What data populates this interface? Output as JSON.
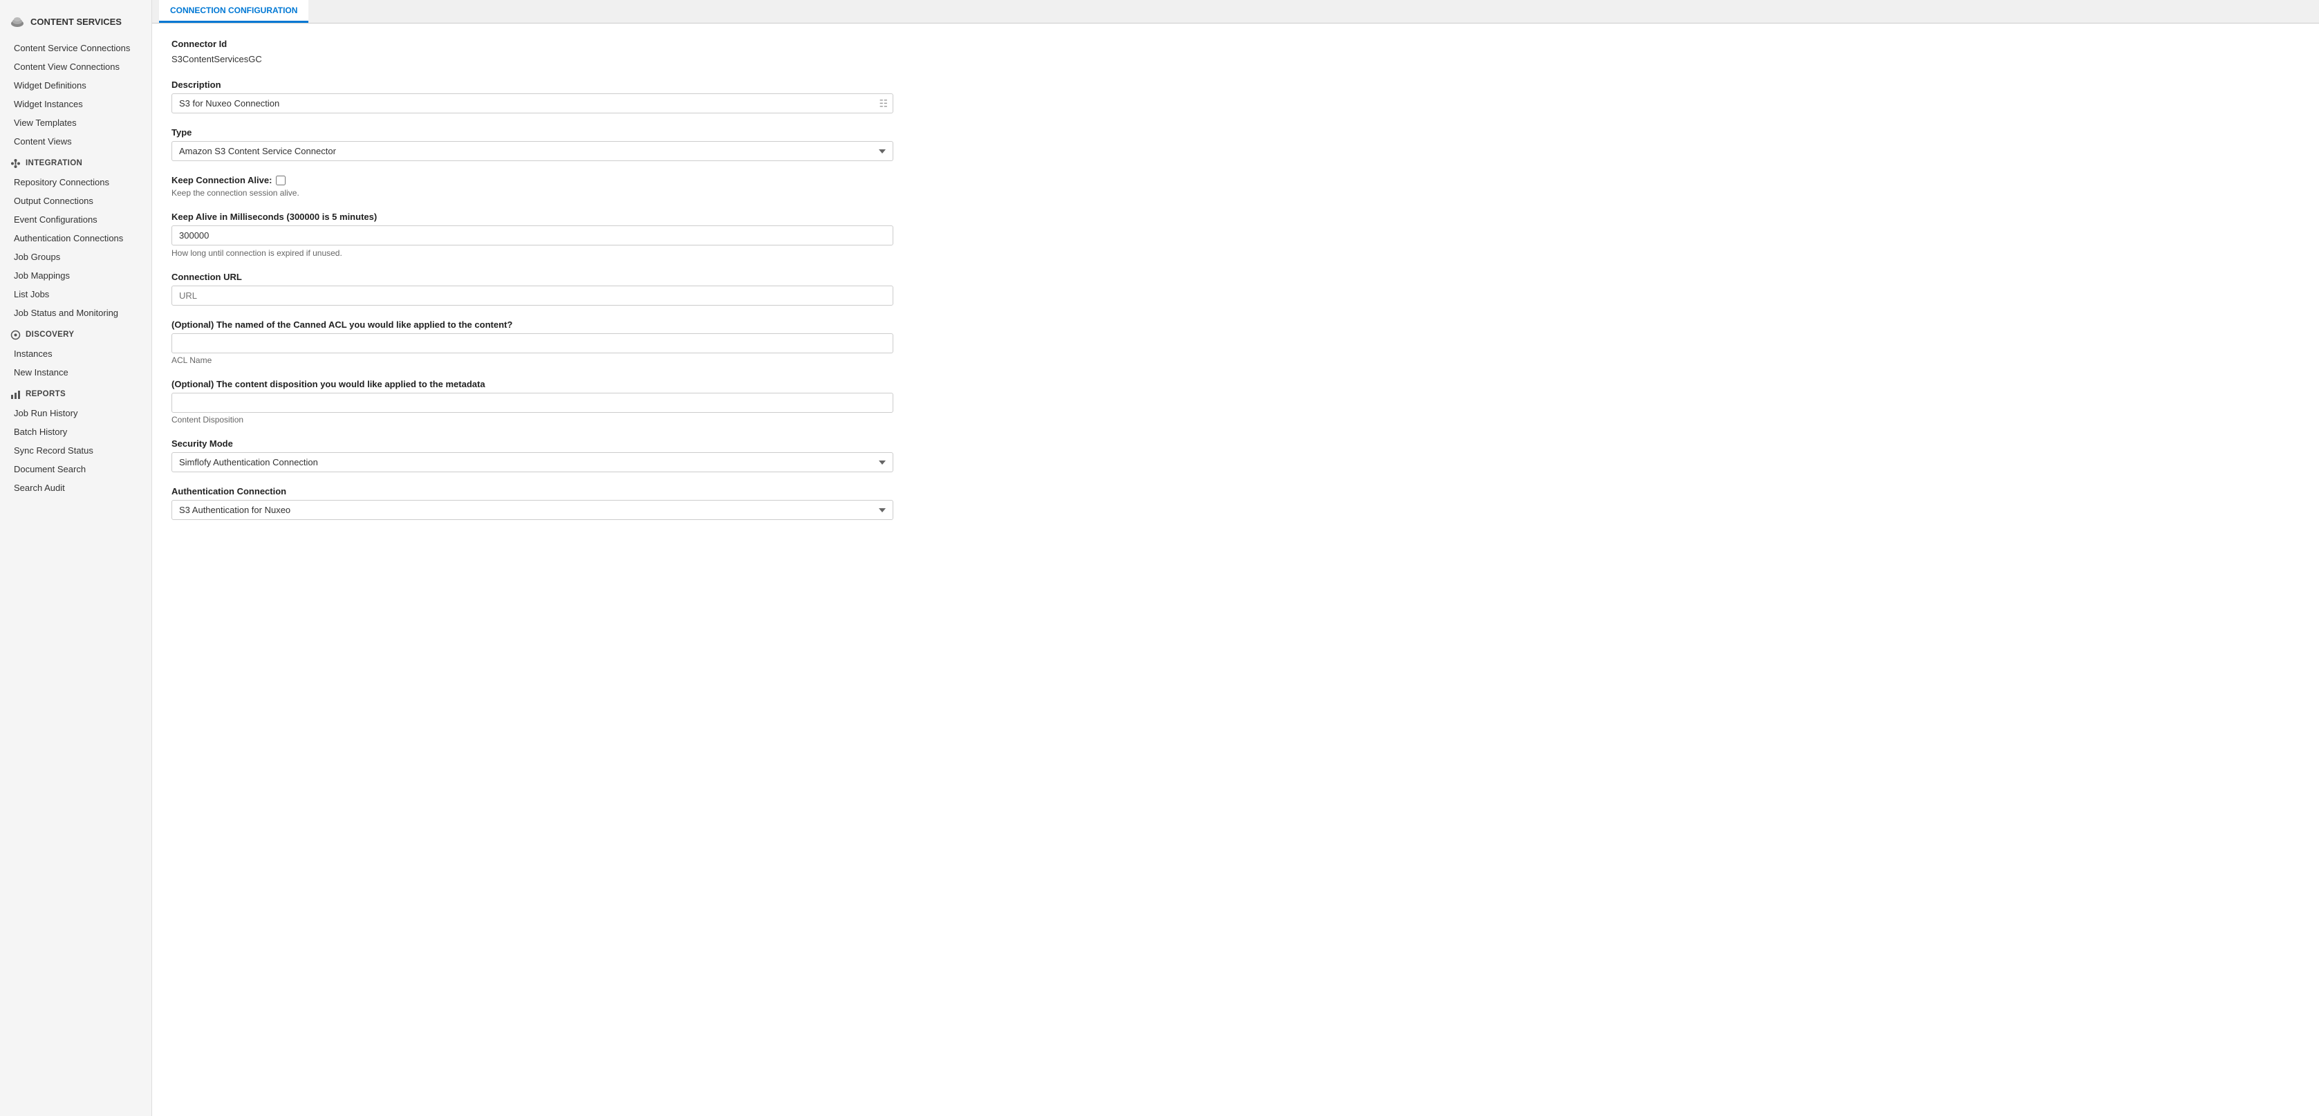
{
  "brand": {
    "icon": "☁",
    "label": "CONTENT SERVICES"
  },
  "sidebar": {
    "sections": [
      {
        "id": "content-services",
        "icon": "cloud",
        "label": "CONTENT SERVICES",
        "items": [
          {
            "id": "content-service-connections",
            "label": "Content Service Connections"
          },
          {
            "id": "content-view-connections",
            "label": "Content View Connections"
          },
          {
            "id": "widget-definitions",
            "label": "Widget Definitions"
          },
          {
            "id": "widget-instances",
            "label": "Widget Instances"
          },
          {
            "id": "view-templates",
            "label": "View Templates"
          },
          {
            "id": "content-views",
            "label": "Content Views"
          }
        ]
      },
      {
        "id": "integration",
        "icon": "stack",
        "label": "INTEGRATION",
        "items": [
          {
            "id": "repository-connections",
            "label": "Repository Connections"
          },
          {
            "id": "output-connections",
            "label": "Output Connections"
          },
          {
            "id": "event-configurations",
            "label": "Event Configurations"
          },
          {
            "id": "authentication-connections",
            "label": "Authentication Connections"
          },
          {
            "id": "job-groups",
            "label": "Job Groups"
          },
          {
            "id": "job-mappings",
            "label": "Job Mappings"
          },
          {
            "id": "list-jobs",
            "label": "List Jobs"
          },
          {
            "id": "job-status-monitoring",
            "label": "Job Status and Monitoring"
          }
        ]
      },
      {
        "id": "discovery",
        "icon": "circle",
        "label": "DISCOVERY",
        "items": [
          {
            "id": "instances",
            "label": "Instances"
          },
          {
            "id": "new-instance",
            "label": "New Instance"
          }
        ]
      },
      {
        "id": "reports",
        "icon": "bar-chart",
        "label": "REPORTS",
        "items": [
          {
            "id": "job-run-history",
            "label": "Job Run History"
          },
          {
            "id": "batch-history",
            "label": "Batch History"
          },
          {
            "id": "sync-record-status",
            "label": "Sync Record Status"
          },
          {
            "id": "document-search",
            "label": "Document Search"
          },
          {
            "id": "search-audit",
            "label": "Search Audit"
          }
        ]
      }
    ]
  },
  "tabs": [
    {
      "id": "connection-config",
      "label": "CONNECTION CONFIGURATION",
      "active": true
    }
  ],
  "form": {
    "connector_id_label": "Connector Id",
    "connector_id_value": "S3ContentServicesGC",
    "description_label": "Description",
    "description_placeholder": "",
    "description_value": "S3 for Nuxeo Connection",
    "type_label": "Type",
    "type_value": "Amazon S3 Content Service Connector",
    "type_options": [
      "Amazon S3 Content Service Connector"
    ],
    "keep_alive_label": "Keep Connection Alive:",
    "keep_alive_hint": "Keep the connection session alive.",
    "keep_alive_ms_label": "Keep Alive in Milliseconds (300000 is 5 minutes)",
    "keep_alive_ms_value": "300000",
    "keep_alive_ms_hint": "How long until connection is expired if unused.",
    "connection_url_label": "Connection URL",
    "connection_url_placeholder": "URL",
    "connection_url_value": "",
    "canned_acl_label": "(Optional) The named of the Canned ACL you would like applied to the content?",
    "canned_acl_value": "",
    "acl_name_hint": "ACL Name",
    "content_disposition_label": "(Optional) The content disposition you would like applied to the metadata",
    "content_disposition_value": "",
    "content_disposition_hint": "Content Disposition",
    "security_mode_label": "Security Mode",
    "security_mode_value": "Simflofy Authentication Connection",
    "security_mode_options": [
      "Simflofy Authentication Connection"
    ],
    "auth_connection_label": "Authentication Connection",
    "auth_connection_value": "S3 Authentication for Nuxeo",
    "auth_connection_options": [
      "S3 Authentication for Nuxeo"
    ]
  }
}
